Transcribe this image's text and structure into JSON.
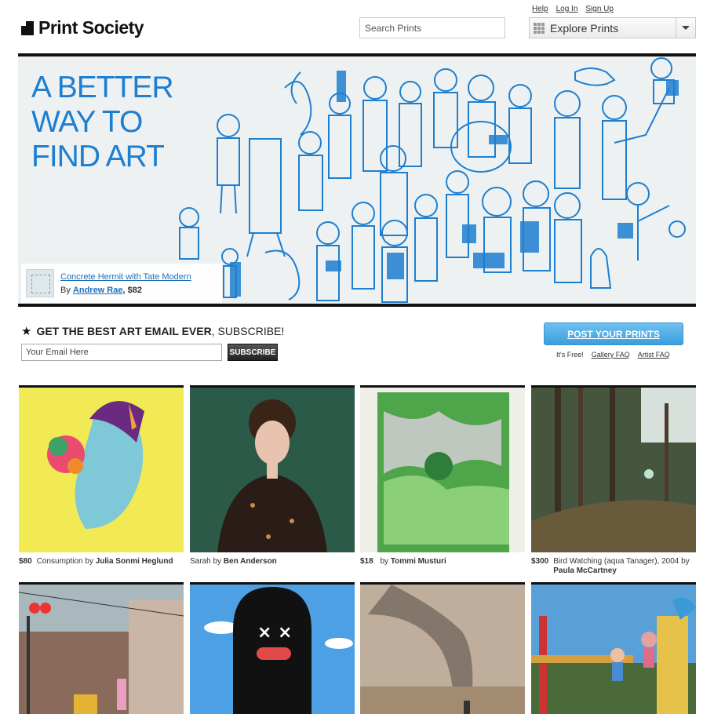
{
  "header": {
    "logo_text": "Print Society",
    "links": [
      "Help",
      "Log In",
      "Sign Up"
    ],
    "search_placeholder": "Search Prints",
    "explore_label": "Explore Prints"
  },
  "hero": {
    "title_lines": [
      "A BETTER",
      "WAY TO",
      "FIND ART"
    ],
    "caption_title": "Concrete Hermit with Tate Modern",
    "caption_by": "By",
    "caption_artist": "Andrew Rae",
    "caption_price": ", $82"
  },
  "subscribe": {
    "heading_bold": "GET THE BEST ART EMAIL EVER",
    "heading_rest": ", SUBSCRIBE!",
    "email_placeholder": "Your Email Here",
    "button": "SUBSCRIBE"
  },
  "post": {
    "button": "POST YOUR PRINTS",
    "free_text": "It's Free!",
    "links": [
      "Gallery FAQ",
      "Artist FAQ"
    ]
  },
  "prints": [
    {
      "price": "$80",
      "title": "Consumption by",
      "artist": "Julia Sonmi Heglund"
    },
    {
      "price": "",
      "title": "Sarah by",
      "artist": "Ben Anderson"
    },
    {
      "price": "$18",
      "title": "by",
      "artist": "Tommi Musturi"
    },
    {
      "price": "$300",
      "title": "Bird Watching (aqua Tanager), 2004 by",
      "artist": "Paula McCartney"
    }
  ],
  "colors": {
    "accent": "#1e7fd0",
    "post_button": "#4aaae6",
    "tile_border": "#111111"
  }
}
